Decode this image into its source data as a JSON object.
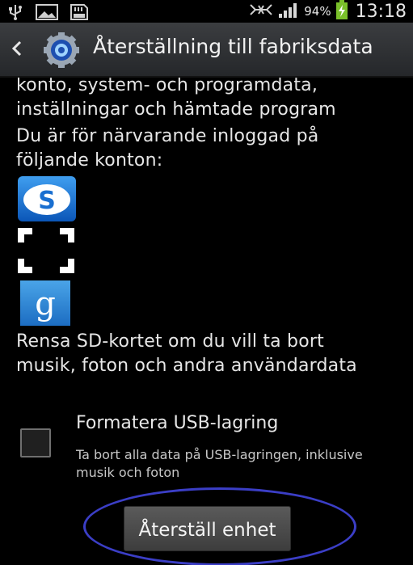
{
  "statusbar": {
    "battery_percent": "94%",
    "time": "13:18",
    "icons": [
      "usb-icon",
      "image-icon",
      "sd-card-icon",
      "no-signal-icon",
      "signal-icon",
      "battery-charging-icon"
    ]
  },
  "header": {
    "title": "Återställning till fabriksdata"
  },
  "content": {
    "intro_line1": "konto, system- och programdata,",
    "intro_line2": "inställningar och hämtade program",
    "accounts_text": "Du är för närvarande inloggad på följande konton:",
    "accounts": [
      "skype-icon",
      "app-brackets-icon",
      "google-icon"
    ],
    "sd_text": "Rensa SD-kortet om du vill ta bort musik, foton och andra användardata",
    "option": {
      "title": "Formatera USB-lagring",
      "subtitle": "Ta bort alla data på USB-lagringen, inklusive musik och foton",
      "checked": false
    },
    "reset_button": "Återställ enhet"
  },
  "colors": {
    "background": "#000000",
    "annotation_ellipse": "#3b3ec6",
    "battery_green": "#7ac02a"
  }
}
